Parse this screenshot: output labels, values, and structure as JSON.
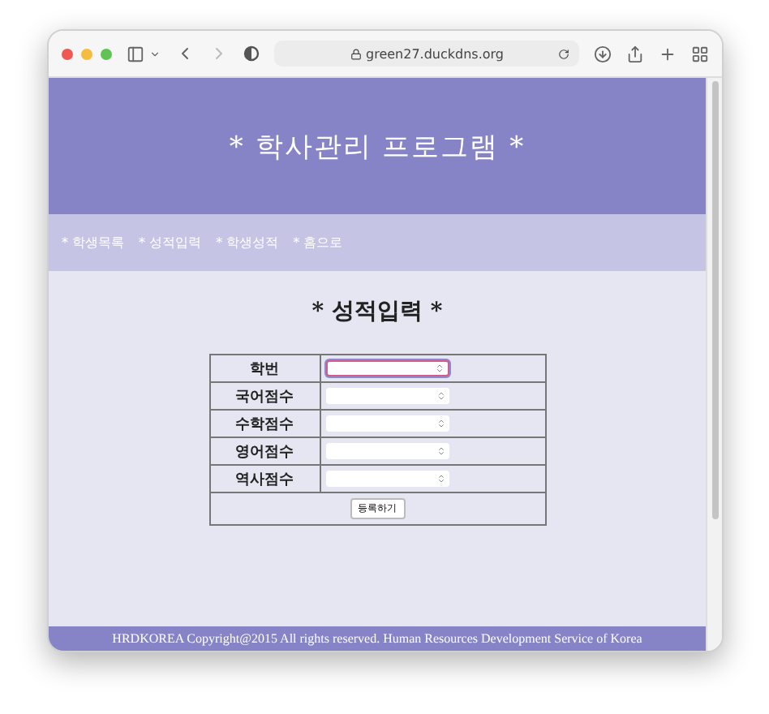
{
  "browser": {
    "url": "green27.duckdns.org"
  },
  "header": {
    "title": "* 학사관리 프로그램 *"
  },
  "nav": {
    "items": [
      {
        "label": "* 학생목록"
      },
      {
        "label": "* 성적입력"
      },
      {
        "label": "* 학생성적"
      },
      {
        "label": "* 홈으로"
      }
    ]
  },
  "form": {
    "title": "* 성적입력 *",
    "rows": [
      {
        "label": "학번",
        "focused": true
      },
      {
        "label": "국어점수",
        "focused": false
      },
      {
        "label": "수학점수",
        "focused": false
      },
      {
        "label": "영어점수",
        "focused": false
      },
      {
        "label": "역사점수",
        "focused": false
      }
    ],
    "submit": "등록하기"
  },
  "footer": {
    "text": "HRDKOREA Copyright@2015 All rights reserved. Human Resources Development Service of Korea"
  }
}
